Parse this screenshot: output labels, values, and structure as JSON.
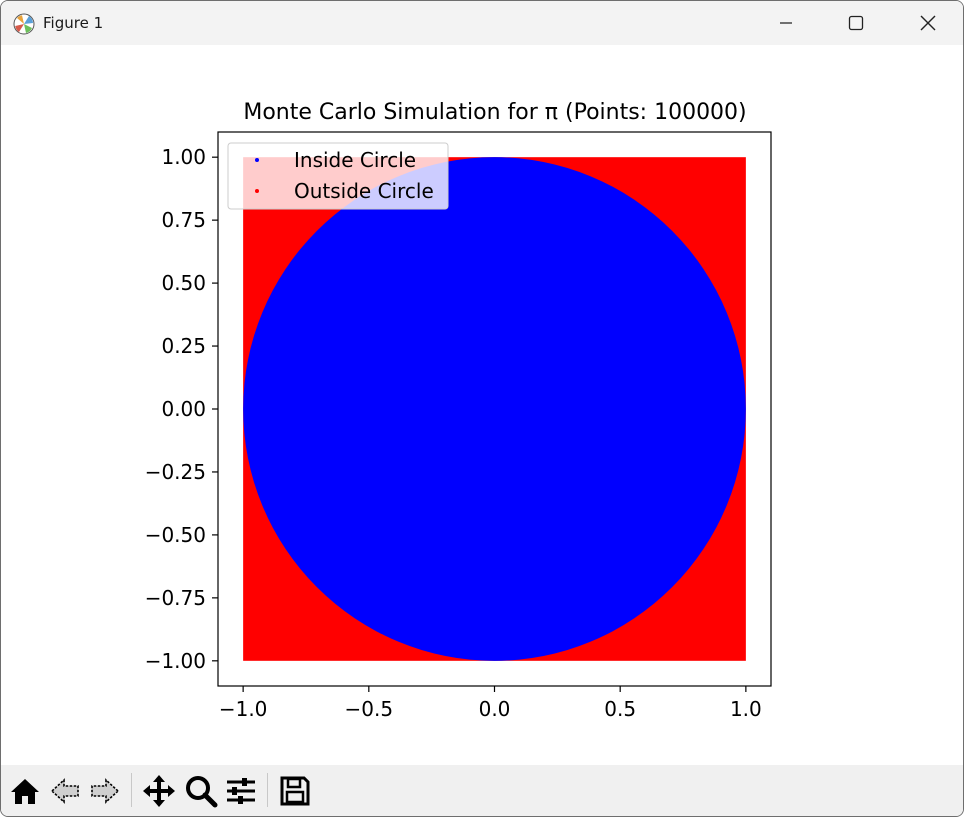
{
  "window": {
    "title": "Figure 1",
    "controls": [
      "minimize-icon",
      "maximize-icon",
      "close-icon"
    ]
  },
  "toolbar": {
    "buttons": [
      {
        "name": "home-icon",
        "label": "Home"
      },
      {
        "name": "back-icon",
        "label": "Back"
      },
      {
        "name": "forward-icon",
        "label": "Forward"
      },
      {
        "name": "pan-icon",
        "label": "Pan"
      },
      {
        "name": "zoom-icon",
        "label": "Zoom"
      },
      {
        "name": "configure-subplots-icon",
        "label": "Configure subplots"
      },
      {
        "name": "save-icon",
        "label": "Save"
      }
    ]
  },
  "chart_data": {
    "type": "scatter",
    "title": "Monte Carlo Simulation for π (Points: 100000)",
    "xlabel": "",
    "ylabel": "",
    "xlim": [
      -1.1,
      1.1
    ],
    "ylim": [
      -1.1,
      1.1
    ],
    "xticks": [
      -1.0,
      -0.5,
      0.0,
      0.5,
      1.0
    ],
    "xtick_labels": [
      "−1.0",
      "−0.5",
      "0.0",
      "0.5",
      "1.0"
    ],
    "yticks": [
      1.0,
      0.75,
      0.5,
      0.25,
      0.0,
      -0.25,
      -0.5,
      -0.75,
      -1.0
    ],
    "ytick_labels": [
      "1.00",
      "0.75",
      "0.50",
      "0.25",
      "0.00",
      "−0.25",
      "−0.50",
      "−0.75",
      "−1.00"
    ],
    "grid": false,
    "legend_position": "upper-left",
    "series": [
      {
        "name": "Inside Circle",
        "color": "#0000ff",
        "region": "x^2 + y^2 <= 1",
        "approx_fraction": 0.785
      },
      {
        "name": "Outside Circle",
        "color": "#ff0000",
        "region": "-1 <= x <= 1, -1 <= y <= 1, x^2 + y^2 > 1",
        "approx_fraction": 0.215
      }
    ],
    "point_count": 100000
  }
}
